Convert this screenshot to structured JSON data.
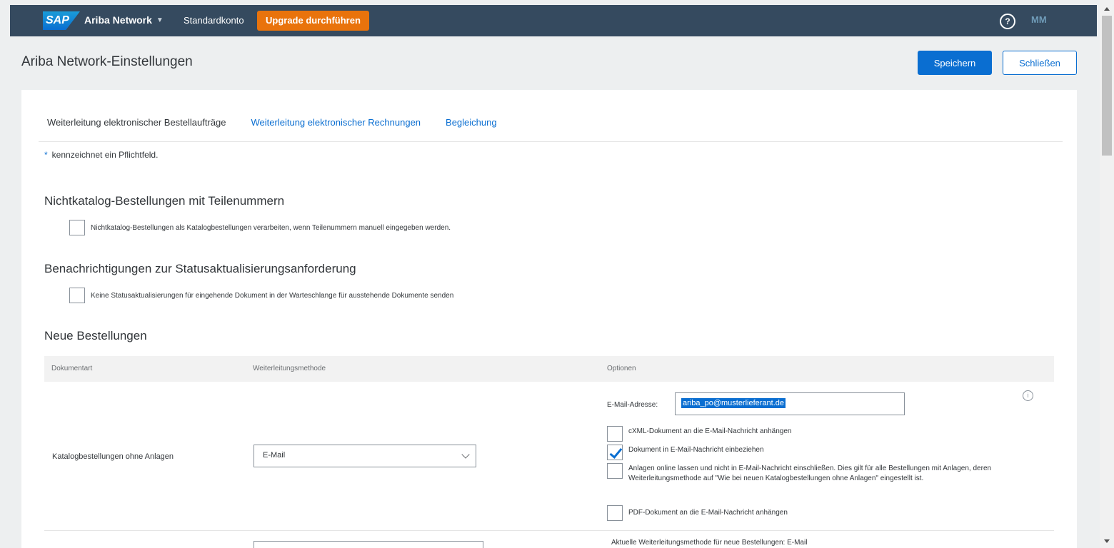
{
  "shellbar": {
    "logo_text": "SAP",
    "product": "Ariba Network",
    "account": "Standardkonto",
    "upgrade_label": "Upgrade durchführen",
    "help_icon": "help-icon",
    "help_glyph": "?",
    "avatar_initials": "MM"
  },
  "header": {
    "title": "Ariba Network-Einstellungen",
    "save_label": "Speichern",
    "close_label": "Schließen"
  },
  "tabs": [
    {
      "label": "Weiterleitung elektronischer Bestellaufträge"
    },
    {
      "label": "Weiterleitung elektronischer Rechnungen"
    },
    {
      "label": "Begleichung"
    }
  ],
  "required_star": "*",
  "required_note": "kennzeichnet ein Pflichtfeld.",
  "sections": {
    "nonCatalog": {
      "title": "Nichtkatalog-Bestellungen mit Teilenummern",
      "checkbox_label": "Nichtkatalog-Bestellungen als Katalogbestellungen verarbeiten, wenn Teilenummern manuell eingegeben werden.",
      "checked": false
    },
    "statusNotify": {
      "title": "Benachrichtigungen zur Statusaktualisierungsanforderung",
      "checkbox_label": "Keine Statusaktualisierungen für eingehende Dokument in der Warteschlange für ausstehende Dokumente senden",
      "checked": false
    },
    "newOrders": {
      "title": "Neue Bestellungen",
      "columns": [
        "Dokumentart",
        "Weiterleitungsmethode",
        "Optionen"
      ],
      "row": {
        "doc_type": "Katalogbestellungen ohne Anlagen",
        "method": "E-Mail",
        "email_label": "E-Mail-Adresse:",
        "email_value": "ariba_po@musterlieferant.de",
        "options": [
          {
            "label": "cXML-Dokument an die E-Mail-Nachricht anhängen",
            "checked": false
          },
          {
            "label": "Dokument in E-Mail-Nachricht einbeziehen",
            "checked": true
          },
          {
            "label": "Anlagen online lassen und nicht in E-Mail-Nachricht einschließen.  Dies gilt für alle Bestellungen mit Anlagen, deren Weiterleitungsmethode auf \"Wie bei neuen Katalogbestellungen ohne Anlagen\" eingestellt ist.",
            "checked": false
          },
          {
            "label": "PDF-Dokument an die E-Mail-Nachricht anhängen",
            "checked": false
          }
        ]
      },
      "next_row_note": "Aktuelle Weiterleitungsmethode für neue Bestellungen: E-Mail"
    }
  },
  "colors": {
    "shellbar": "#354a5f",
    "brand_blue": "#0a6ed1",
    "upgrade_orange": "#e9730c"
  }
}
